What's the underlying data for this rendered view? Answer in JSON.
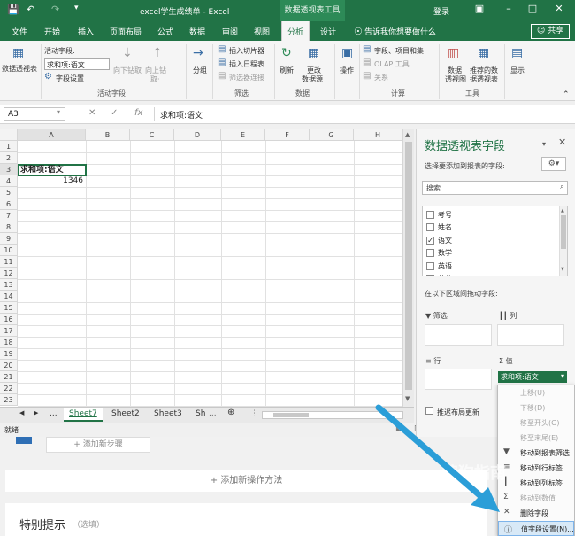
{
  "titlebar": {
    "doc_title": "excel学生成绩单 - Excel",
    "context_tools": "数据透视表工具",
    "login": "登录",
    "share": "共享"
  },
  "tabs": [
    "文件",
    "开始",
    "插入",
    "页面布局",
    "公式",
    "数据",
    "审阅",
    "视图",
    "分析",
    "设计"
  ],
  "tell_me": "告诉我你想要做什么",
  "ribbon": {
    "pivot_table": "数据透视表",
    "active_field_label": "活动字段:",
    "active_field_value": "求和项:语文",
    "field_settings": "字段设置",
    "drill_down": "向下钻取",
    "drill_up": "向上钻",
    "drill_up_2": "取·",
    "group_active": "活动字段",
    "group_btn": "分组",
    "insert_slicer": "插入切片器",
    "insert_timeline": "插入日程表",
    "filter_connections": "筛选器连接",
    "group_filter": "筛选",
    "refresh": "刷新",
    "change_source": "更改",
    "change_source_2": "数据源",
    "group_data": "数据",
    "actions": "操作",
    "fields_items": "字段、项目和集",
    "olap_tools": "OLAP 工具",
    "relationships": "关系",
    "group_calc": "计算",
    "pivot_chart": "数据",
    "pivot_chart_2": "透视图",
    "recommended": "推荐的数",
    "recommended_2": "据透视表",
    "group_tools": "工具",
    "show": "显示"
  },
  "formula_bar": {
    "name_box": "A3",
    "formula": "求和项:语文"
  },
  "grid": {
    "columns": [
      "A",
      "B",
      "C",
      "D",
      "E",
      "F",
      "G",
      "H"
    ],
    "rows": [
      "1",
      "2",
      "3",
      "4",
      "5",
      "6",
      "7",
      "8",
      "9",
      "10",
      "11",
      "12",
      "13",
      "14",
      "15",
      "16",
      "17",
      "18",
      "19",
      "20",
      "21",
      "22",
      "23"
    ],
    "a3": "求和项:语文",
    "a4": "1346"
  },
  "sheets": [
    "Sheet7",
    "Sheet2",
    "Sheet3",
    "Sh"
  ],
  "status": "就绪",
  "page_below": {
    "add_step": "添加新步骤",
    "add_method": "添加新操作方法",
    "tips": "特别提示",
    "tips_optional": "（选填）"
  },
  "pivot_pane": {
    "title": "数据透视表字段",
    "subtitle": "选择要添加到报表的字段:",
    "search": "搜索",
    "fields": [
      {
        "name": "考号",
        "checked": false
      },
      {
        "name": "姓名",
        "checked": false
      },
      {
        "name": "语文",
        "checked": true
      },
      {
        "name": "数学",
        "checked": false
      },
      {
        "name": "英语",
        "checked": false
      },
      {
        "name": "总分",
        "checked": false
      }
    ],
    "drag_hint": "在以下区域间拖动字段:",
    "areas": {
      "filter": "筛选",
      "columns": "列",
      "rows": "行",
      "values": "值"
    },
    "value_item": "求和项:语文",
    "defer": "推迟布局更新"
  },
  "context_menu": [
    {
      "label": "上移(U)",
      "disabled": true
    },
    {
      "label": "下移(D)",
      "disabled": true
    },
    {
      "label": "移至开头(G)",
      "disabled": true
    },
    {
      "label": "移至末尾(E)",
      "disabled": true
    },
    {
      "label": "移动到报表筛选",
      "disabled": false
    },
    {
      "label": "移动到行标签",
      "disabled": false
    },
    {
      "label": "移动到列标签",
      "disabled": false
    },
    {
      "label": "移动到数值",
      "disabled": true
    },
    {
      "label": "删除字段",
      "disabled": false
    },
    {
      "label": "值字段设置(N)...",
      "disabled": false
    }
  ],
  "watermark": "搜狗指南"
}
